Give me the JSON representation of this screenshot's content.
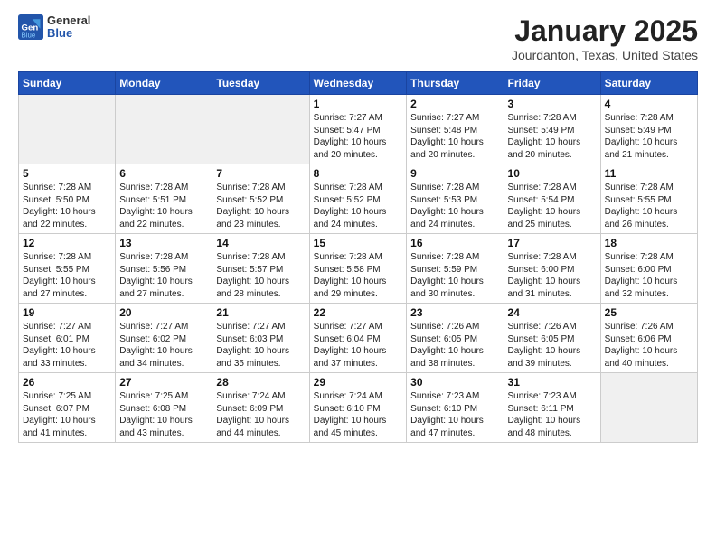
{
  "header": {
    "logo": {
      "general": "General",
      "blue": "Blue"
    },
    "title": "January 2025",
    "location": "Jourdanton, Texas, United States"
  },
  "weekdays": [
    "Sunday",
    "Monday",
    "Tuesday",
    "Wednesday",
    "Thursday",
    "Friday",
    "Saturday"
  ],
  "weeks": [
    [
      {
        "day": "",
        "info": ""
      },
      {
        "day": "",
        "info": ""
      },
      {
        "day": "",
        "info": ""
      },
      {
        "day": "1",
        "info": "Sunrise: 7:27 AM\nSunset: 5:47 PM\nDaylight: 10 hours\nand 20 minutes."
      },
      {
        "day": "2",
        "info": "Sunrise: 7:27 AM\nSunset: 5:48 PM\nDaylight: 10 hours\nand 20 minutes."
      },
      {
        "day": "3",
        "info": "Sunrise: 7:28 AM\nSunset: 5:49 PM\nDaylight: 10 hours\nand 20 minutes."
      },
      {
        "day": "4",
        "info": "Sunrise: 7:28 AM\nSunset: 5:49 PM\nDaylight: 10 hours\nand 21 minutes."
      }
    ],
    [
      {
        "day": "5",
        "info": "Sunrise: 7:28 AM\nSunset: 5:50 PM\nDaylight: 10 hours\nand 22 minutes."
      },
      {
        "day": "6",
        "info": "Sunrise: 7:28 AM\nSunset: 5:51 PM\nDaylight: 10 hours\nand 22 minutes."
      },
      {
        "day": "7",
        "info": "Sunrise: 7:28 AM\nSunset: 5:52 PM\nDaylight: 10 hours\nand 23 minutes."
      },
      {
        "day": "8",
        "info": "Sunrise: 7:28 AM\nSunset: 5:52 PM\nDaylight: 10 hours\nand 24 minutes."
      },
      {
        "day": "9",
        "info": "Sunrise: 7:28 AM\nSunset: 5:53 PM\nDaylight: 10 hours\nand 24 minutes."
      },
      {
        "day": "10",
        "info": "Sunrise: 7:28 AM\nSunset: 5:54 PM\nDaylight: 10 hours\nand 25 minutes."
      },
      {
        "day": "11",
        "info": "Sunrise: 7:28 AM\nSunset: 5:55 PM\nDaylight: 10 hours\nand 26 minutes."
      }
    ],
    [
      {
        "day": "12",
        "info": "Sunrise: 7:28 AM\nSunset: 5:55 PM\nDaylight: 10 hours\nand 27 minutes."
      },
      {
        "day": "13",
        "info": "Sunrise: 7:28 AM\nSunset: 5:56 PM\nDaylight: 10 hours\nand 27 minutes."
      },
      {
        "day": "14",
        "info": "Sunrise: 7:28 AM\nSunset: 5:57 PM\nDaylight: 10 hours\nand 28 minutes."
      },
      {
        "day": "15",
        "info": "Sunrise: 7:28 AM\nSunset: 5:58 PM\nDaylight: 10 hours\nand 29 minutes."
      },
      {
        "day": "16",
        "info": "Sunrise: 7:28 AM\nSunset: 5:59 PM\nDaylight: 10 hours\nand 30 minutes."
      },
      {
        "day": "17",
        "info": "Sunrise: 7:28 AM\nSunset: 6:00 PM\nDaylight: 10 hours\nand 31 minutes."
      },
      {
        "day": "18",
        "info": "Sunrise: 7:28 AM\nSunset: 6:00 PM\nDaylight: 10 hours\nand 32 minutes."
      }
    ],
    [
      {
        "day": "19",
        "info": "Sunrise: 7:27 AM\nSunset: 6:01 PM\nDaylight: 10 hours\nand 33 minutes."
      },
      {
        "day": "20",
        "info": "Sunrise: 7:27 AM\nSunset: 6:02 PM\nDaylight: 10 hours\nand 34 minutes."
      },
      {
        "day": "21",
        "info": "Sunrise: 7:27 AM\nSunset: 6:03 PM\nDaylight: 10 hours\nand 35 minutes."
      },
      {
        "day": "22",
        "info": "Sunrise: 7:27 AM\nSunset: 6:04 PM\nDaylight: 10 hours\nand 37 minutes."
      },
      {
        "day": "23",
        "info": "Sunrise: 7:26 AM\nSunset: 6:05 PM\nDaylight: 10 hours\nand 38 minutes."
      },
      {
        "day": "24",
        "info": "Sunrise: 7:26 AM\nSunset: 6:05 PM\nDaylight: 10 hours\nand 39 minutes."
      },
      {
        "day": "25",
        "info": "Sunrise: 7:26 AM\nSunset: 6:06 PM\nDaylight: 10 hours\nand 40 minutes."
      }
    ],
    [
      {
        "day": "26",
        "info": "Sunrise: 7:25 AM\nSunset: 6:07 PM\nDaylight: 10 hours\nand 41 minutes."
      },
      {
        "day": "27",
        "info": "Sunrise: 7:25 AM\nSunset: 6:08 PM\nDaylight: 10 hours\nand 43 minutes."
      },
      {
        "day": "28",
        "info": "Sunrise: 7:24 AM\nSunset: 6:09 PM\nDaylight: 10 hours\nand 44 minutes."
      },
      {
        "day": "29",
        "info": "Sunrise: 7:24 AM\nSunset: 6:10 PM\nDaylight: 10 hours\nand 45 minutes."
      },
      {
        "day": "30",
        "info": "Sunrise: 7:23 AM\nSunset: 6:10 PM\nDaylight: 10 hours\nand 47 minutes."
      },
      {
        "day": "31",
        "info": "Sunrise: 7:23 AM\nSunset: 6:11 PM\nDaylight: 10 hours\nand 48 minutes."
      },
      {
        "day": "",
        "info": ""
      }
    ]
  ]
}
